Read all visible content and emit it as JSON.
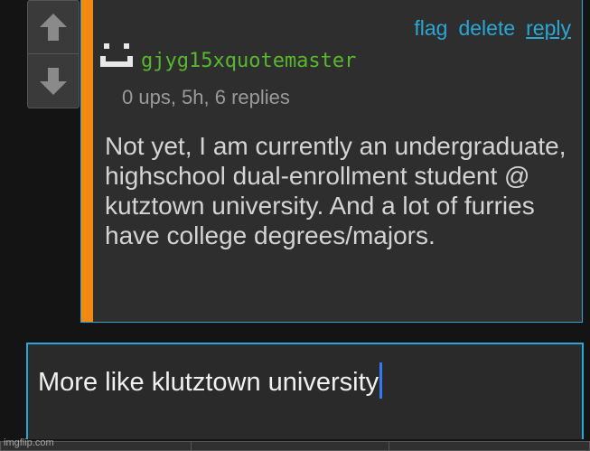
{
  "vote": {
    "up_icon": "arrow-up-icon",
    "down_icon": "arrow-down-icon"
  },
  "comment": {
    "actions": {
      "flag": "flag",
      "delete": "delete",
      "reply": "reply"
    },
    "avatar_icon": "face-icon",
    "username": "gjyg15xquotemaster",
    "meta": "0 ups, 5h, 6 replies",
    "body": "Not yet, I am currently an undergraduate, highschool dual-enrollment student @ kutztown university. And a lot of furries have college degrees/majors.",
    "colors": {
      "accent": "#f28a11",
      "link": "#2aa7d4",
      "username": "#57b82e"
    }
  },
  "reply_box": {
    "value": "More like klutztown university"
  },
  "watermark": "imgflip.com"
}
